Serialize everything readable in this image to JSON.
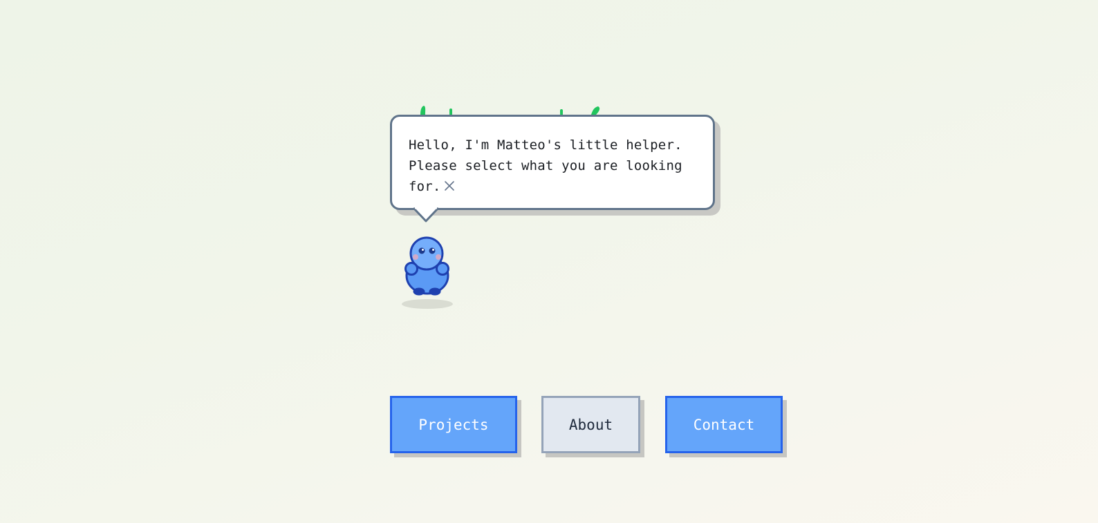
{
  "speech_bubble": {
    "text": "Hello, I'm Matteo's little helper. Please select what you are looking for."
  },
  "nav": {
    "projects_label": "Projects",
    "about_label": "About",
    "contact_label": "Contact"
  },
  "colors": {
    "primary_fill": "#64a5fa",
    "primary_border": "#2563eb",
    "secondary_fill": "#e2e8f0",
    "secondary_border": "#94a3b8",
    "bubble_border": "#5f738a",
    "helper_body": "#5b9af5",
    "helper_outline": "#1e40af",
    "sprout_green": "#22c55e"
  },
  "icons": {
    "close": "close-icon",
    "sprouts": "sprout-icon",
    "helper": "helper-character"
  }
}
